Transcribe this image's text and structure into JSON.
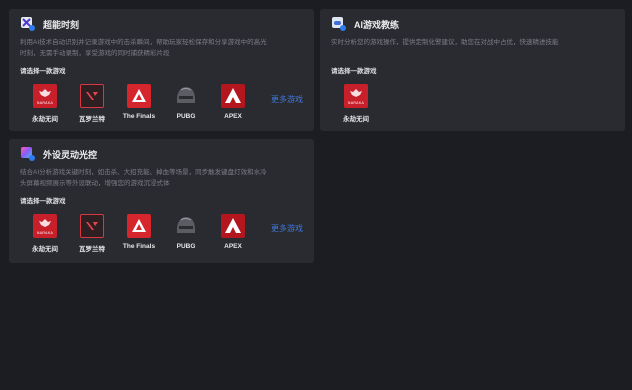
{
  "cards": [
    {
      "title": "超能时刻",
      "desc1": "利用AI技术自动识别并记录游戏中的击杀瞬间，帮助玩家轻松保存和分享游戏中的高光",
      "desc2": "时刻，无需手动录制，享受游戏的同时捕获精彩片段",
      "prompt": "请选择一款游戏",
      "more": "更多游戏",
      "games": [
        "永劫无间",
        "瓦罗兰特",
        "The Finals",
        "PUBG",
        "APEX"
      ]
    },
    {
      "title": "AI游戏教练",
      "desc1": "实时分析您的游戏操作，提供定制化警建议，助您在对战中占优，快速精进技能",
      "prompt": "请选择一款游戏",
      "games": [
        "永劫无间"
      ]
    },
    {
      "title": "外设灵动光控",
      "desc1": "结合AI分析游戏关键时刻，如击杀、大招充能、掉血等场景，同步触发键盘灯效和水冷",
      "desc2": "头屏幕视频展示等外设联动，增强您的游戏沉浸式体",
      "prompt": "请选择一款游戏",
      "more": "更多游戏",
      "games": [
        "永劫无间",
        "瓦罗兰特",
        "The Finals",
        "PUBG",
        "APEX"
      ]
    }
  ],
  "tile_text": {
    "naraka": "NARAKA"
  },
  "colors": {
    "background": "#1c1d22",
    "card": "#2a2b31",
    "link": "#3f78d6",
    "naraka_red": "#c7202a",
    "valorant_red": "#d8373f",
    "apex_red": "#b3161c"
  },
  "icons": {
    "card1": "x-slash-app-icon",
    "card2": "gamepad-coach-icon",
    "card3": "rgb-light-icon"
  }
}
